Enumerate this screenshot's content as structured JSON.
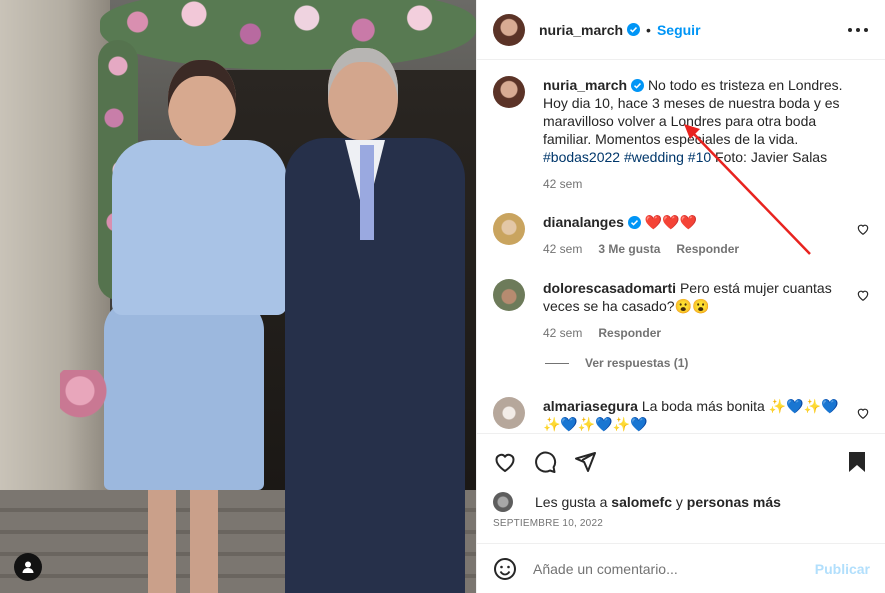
{
  "post": {
    "author": "nuria_march",
    "follow_label": "Seguir",
    "separator": "•",
    "more_icon": "more-horizontal-icon"
  },
  "caption": {
    "author": "nuria_march",
    "text": "No todo es tristeza en Londres. Hoy dia 10, hace 3 meses de nuestra boda y es maravilloso volver a Londres para otra boda familiar. Momentos especiales de la vida.",
    "hashtags": [
      "#bodas2022",
      "#wedding",
      "#10"
    ],
    "credit": "Foto: Javier Salas",
    "time": "42 sem"
  },
  "comments": [
    {
      "user": "dianalanges",
      "verified": true,
      "text": "❤️❤️❤️",
      "time": "42 sem",
      "likes": "3 Me gusta",
      "reply_label": "Responder"
    },
    {
      "user": "dolorescasadomarti",
      "verified": false,
      "text": "Pero está mujer cuantas veces se ha casado?😮😮",
      "time": "42 sem",
      "reply_label": "Responder"
    },
    {
      "user": "almariasegura",
      "verified": false,
      "text": "La boda más bonita ✨💙✨💙 ✨💙✨💙✨💙"
    }
  ],
  "view_replies": "Ver respuestas (1)",
  "likes_summary": {
    "prefix": "Les gusta a",
    "user": "salomefc",
    "conj": "y",
    "others": "personas más"
  },
  "date": "SEPTIEMBRE 10, 2022",
  "add_comment": {
    "placeholder": "Añade un comentario...",
    "publish_label": "Publicar"
  },
  "colors": {
    "accent": "#0095f6",
    "verified": "#0095f6",
    "arrow": "#e8231f",
    "text": "#262626",
    "muted": "#737373"
  }
}
